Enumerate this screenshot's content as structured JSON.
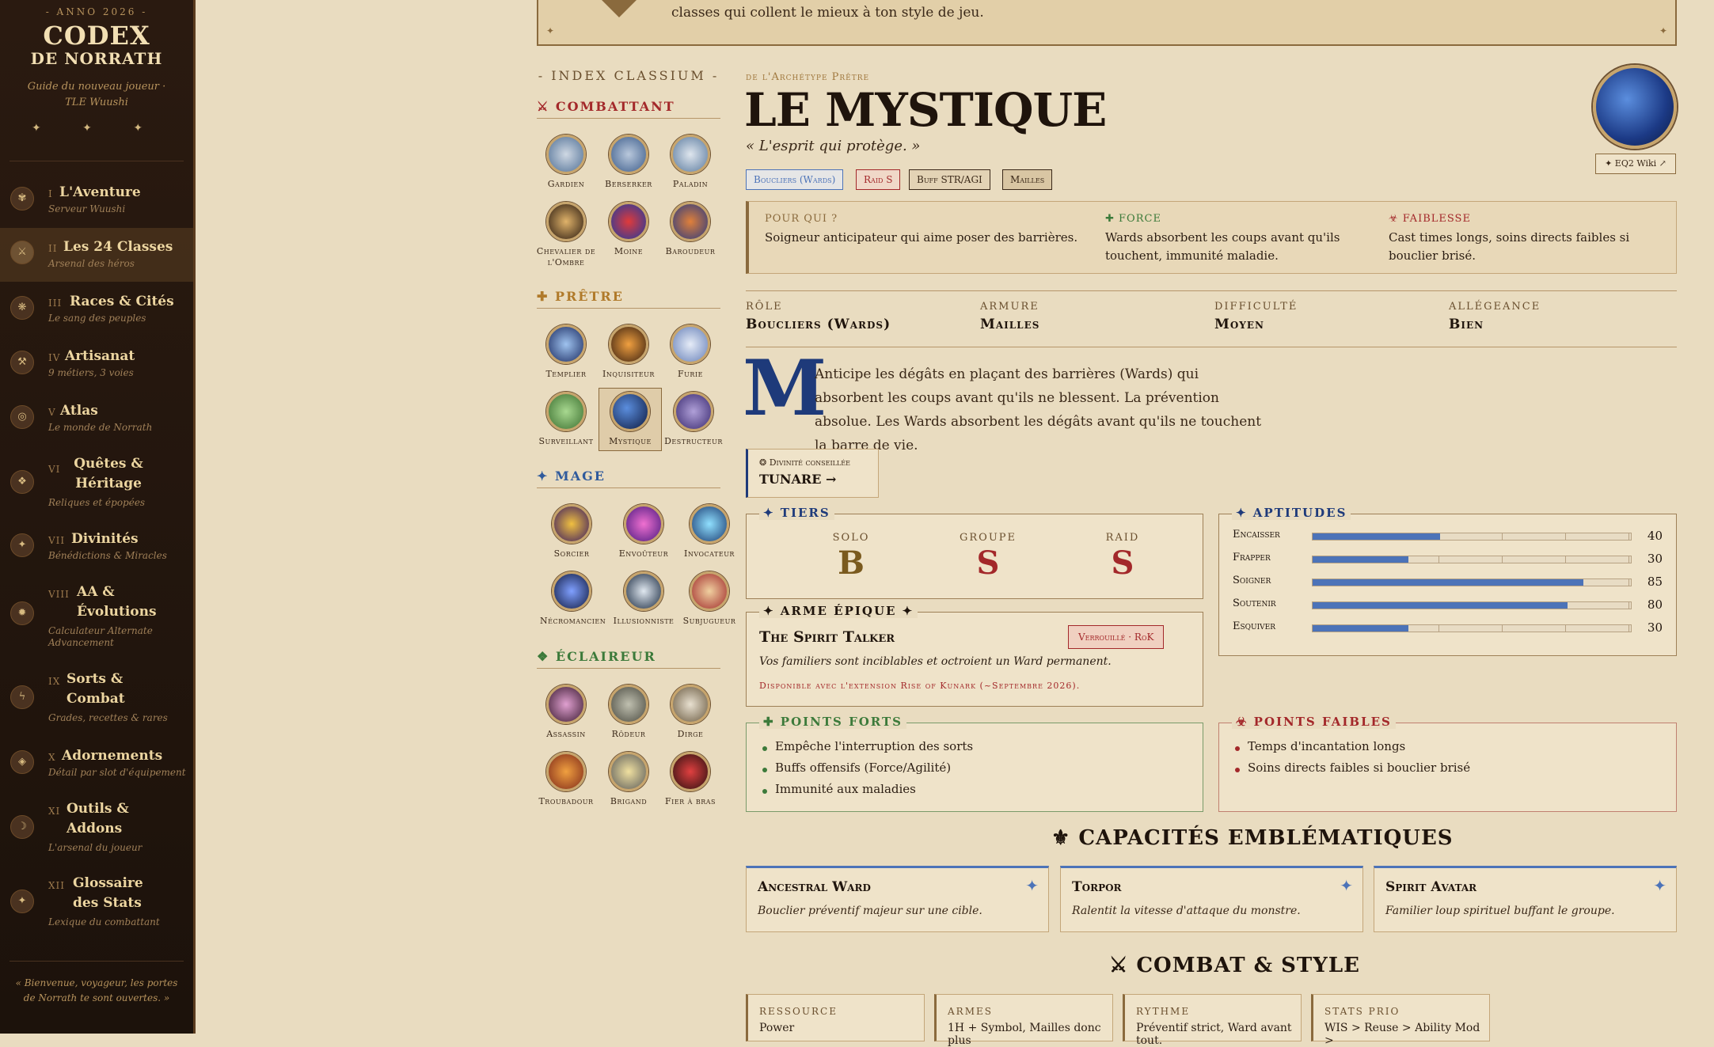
{
  "sidebar": {
    "anno": "- ANNO 2026 -",
    "title": "CODEX",
    "subtitle": "DE NORRATH",
    "tagline": "Guide du nouveau joueur · TLE Wuushi",
    "stars": "✦ ✦ ✦",
    "nav": [
      {
        "num": "I",
        "label": "L'Aventure",
        "sub": "Serveur Wuushi",
        "icon": "✾"
      },
      {
        "num": "II",
        "label": "Les 24 Classes",
        "sub": "Arsenal des héros",
        "icon": "⚔"
      },
      {
        "num": "III",
        "label": "Races & Cités",
        "sub": "Le sang des peuples",
        "icon": "❋"
      },
      {
        "num": "IV",
        "label": "Artisanat",
        "sub": "9 métiers, 3 voies",
        "icon": "⚒"
      },
      {
        "num": "V",
        "label": "Atlas",
        "sub": "Le monde de Norrath",
        "icon": "◎"
      },
      {
        "num": "VI",
        "label": "Quêtes & Héritage",
        "sub": "Reliques et épopées",
        "icon": "❖"
      },
      {
        "num": "VII",
        "label": "Divinités",
        "sub": "Bénédictions & Miracles",
        "icon": "✦"
      },
      {
        "num": "VIII",
        "label": "AA & Évolutions",
        "sub": "Calculateur Alternate Advancement",
        "icon": "✹"
      },
      {
        "num": "IX",
        "label": "Sorts & Combat",
        "sub": "Grades, recettes & rares",
        "icon": "ϟ"
      },
      {
        "num": "X",
        "label": "Adornements",
        "sub": "Détail par slot d'équipement",
        "icon": "◈"
      },
      {
        "num": "XI",
        "label": "Outils & Addons",
        "sub": "L'arsenal du joueur",
        "icon": "☽"
      },
      {
        "num": "XII",
        "label": "Glossaire des Stats",
        "sub": "Lexique du combattant",
        "icon": "✦"
      }
    ],
    "footer": "« Bienvenue, voyageur, les portes de Norrath te sont ouvertes. »"
  },
  "banner": {
    "text": "classes qui collent le mieux à ton style de jeu."
  },
  "index": {
    "title": "- INDEX CLASSIUM -",
    "sections": [
      {
        "name": "⚔ COMBATTANT",
        "color": "#a3282a",
        "classes": [
          "Gardien",
          "Berserker",
          "Paladin",
          "Chevalier de l'Ombre",
          "Moine",
          "Baroudeur"
        ]
      },
      {
        "name": "✚ PRÊTRE",
        "color": "#b07a2a",
        "classes": [
          "Templier",
          "Inquisiteur",
          "Furie",
          "Surveillant",
          "Mystique",
          "Destructeur"
        ]
      },
      {
        "name": "✦ MAGE",
        "color": "#2f5a9c",
        "classes": [
          "Sorcier",
          "Envoûteur",
          "Invocateur",
          "Nécromancien",
          "Illusionniste",
          "Subjugueur"
        ]
      },
      {
        "name": "❖ ÉCLAIREUR",
        "color": "#3c7a3a",
        "classes": [
          "Assassin",
          "Rôdeur",
          "Dirge",
          "Troubadour",
          "Brigand",
          "Fier à bras"
        ]
      }
    ]
  },
  "detail": {
    "archetype": "de l'Archétype Prêtre",
    "name": "LE MYSTIQUE",
    "motto": "« L'esprit qui protège. »",
    "tags": [
      "Boucliers (Wards)",
      "Raid S",
      "Buff STR/AGI",
      "Mailles"
    ],
    "wiki": "✦ EQ2 Wiki ↗",
    "pour_qui_label": "POUR QUI ?",
    "pour_qui": "Soigneur anticipateur qui aime poser des barrières.",
    "force_label": "✚ FORCE",
    "force": "Wards absorbent les coups avant qu'ils touchent, immunité maladie.",
    "faiblesse_label": "☣ FAIBLESSE",
    "faiblesse": "Cast times longs, soins directs faibles si bouclier brisé.",
    "stats": [
      {
        "label": "RÔLE",
        "value": "Boucliers (Wards)"
      },
      {
        "label": "ARMURE",
        "value": "Mailles"
      },
      {
        "label": "DIFFICULTÉ",
        "value": "Moyen"
      },
      {
        "label": "ALLÉGEANCE",
        "value": "Bien"
      }
    ],
    "dropcap": "M",
    "description": "Anticipe les dégâts en plaçant des barrières (Wards) qui absorbent les coups avant qu'ils ne blessent. La prévention absolue. Les Wards absorbent les dégâts avant qu'ils ne touchent la barre de vie.",
    "divinity_label": "❂ Divinité conseillée",
    "divinity": "TUNARE →"
  },
  "tiers": {
    "title": "✦ TIERS",
    "items": [
      {
        "label": "SOLO",
        "grade": "B",
        "color": "#7a5a1e"
      },
      {
        "label": "GROUPE",
        "grade": "S",
        "color": "#a3282a"
      },
      {
        "label": "RAID",
        "grade": "S",
        "color": "#a3282a"
      }
    ]
  },
  "aptitudes": {
    "title": "✦ APTITUDES",
    "items": [
      {
        "label": "Encaisser",
        "value": 40
      },
      {
        "label": "Frapper",
        "value": 30
      },
      {
        "label": "Soigner",
        "value": 85
      },
      {
        "label": "Soutenir",
        "value": 80
      },
      {
        "label": "Esquiver",
        "value": 30
      }
    ]
  },
  "epic": {
    "title": "✦ ARME ÉPIQUE ✦",
    "name": "The Spirit Talker",
    "status": "Verrouillé · RoK",
    "desc": "Vos familiers sont inciblables et octroient un Ward permanent.",
    "note": "Disponible avec l'extension Rise of Kunark (~Septembre 2026)."
  },
  "strengths": {
    "title": "✚ POINTS FORTS",
    "items": [
      "Empêche l'interruption des sorts",
      "Buffs offensifs (Force/Agilité)",
      "Immunité aux maladies"
    ]
  },
  "weaknesses": {
    "title": "☣ POINTS FAIBLES",
    "items": [
      "Temps d'incantation longs",
      "Soins directs faibles si bouclier brisé"
    ]
  },
  "abilities": {
    "title": "⚜ CAPACITÉS EMBLÉMATIQUES",
    "items": [
      {
        "name": "Ancestral Ward",
        "desc": "Bouclier préventif majeur sur une cible."
      },
      {
        "name": "Torpor",
        "desc": "Ralentit la vitesse d'attaque du monstre."
      },
      {
        "name": "Spirit Avatar",
        "desc": "Familier loup spirituel buffant le groupe."
      }
    ]
  },
  "combat": {
    "title": "⚔ COMBAT & STYLE",
    "items": [
      {
        "label": "RESSOURCE",
        "value": "Power"
      },
      {
        "label": "ARMES",
        "value": "1H + Symbol, Mailles donc plus"
      },
      {
        "label": "RYTHME",
        "value": "Préventif strict, Ward avant tout."
      },
      {
        "label": "STATS PRIO",
        "value": "WIS > Reuse > Ability Mod >"
      }
    ]
  }
}
